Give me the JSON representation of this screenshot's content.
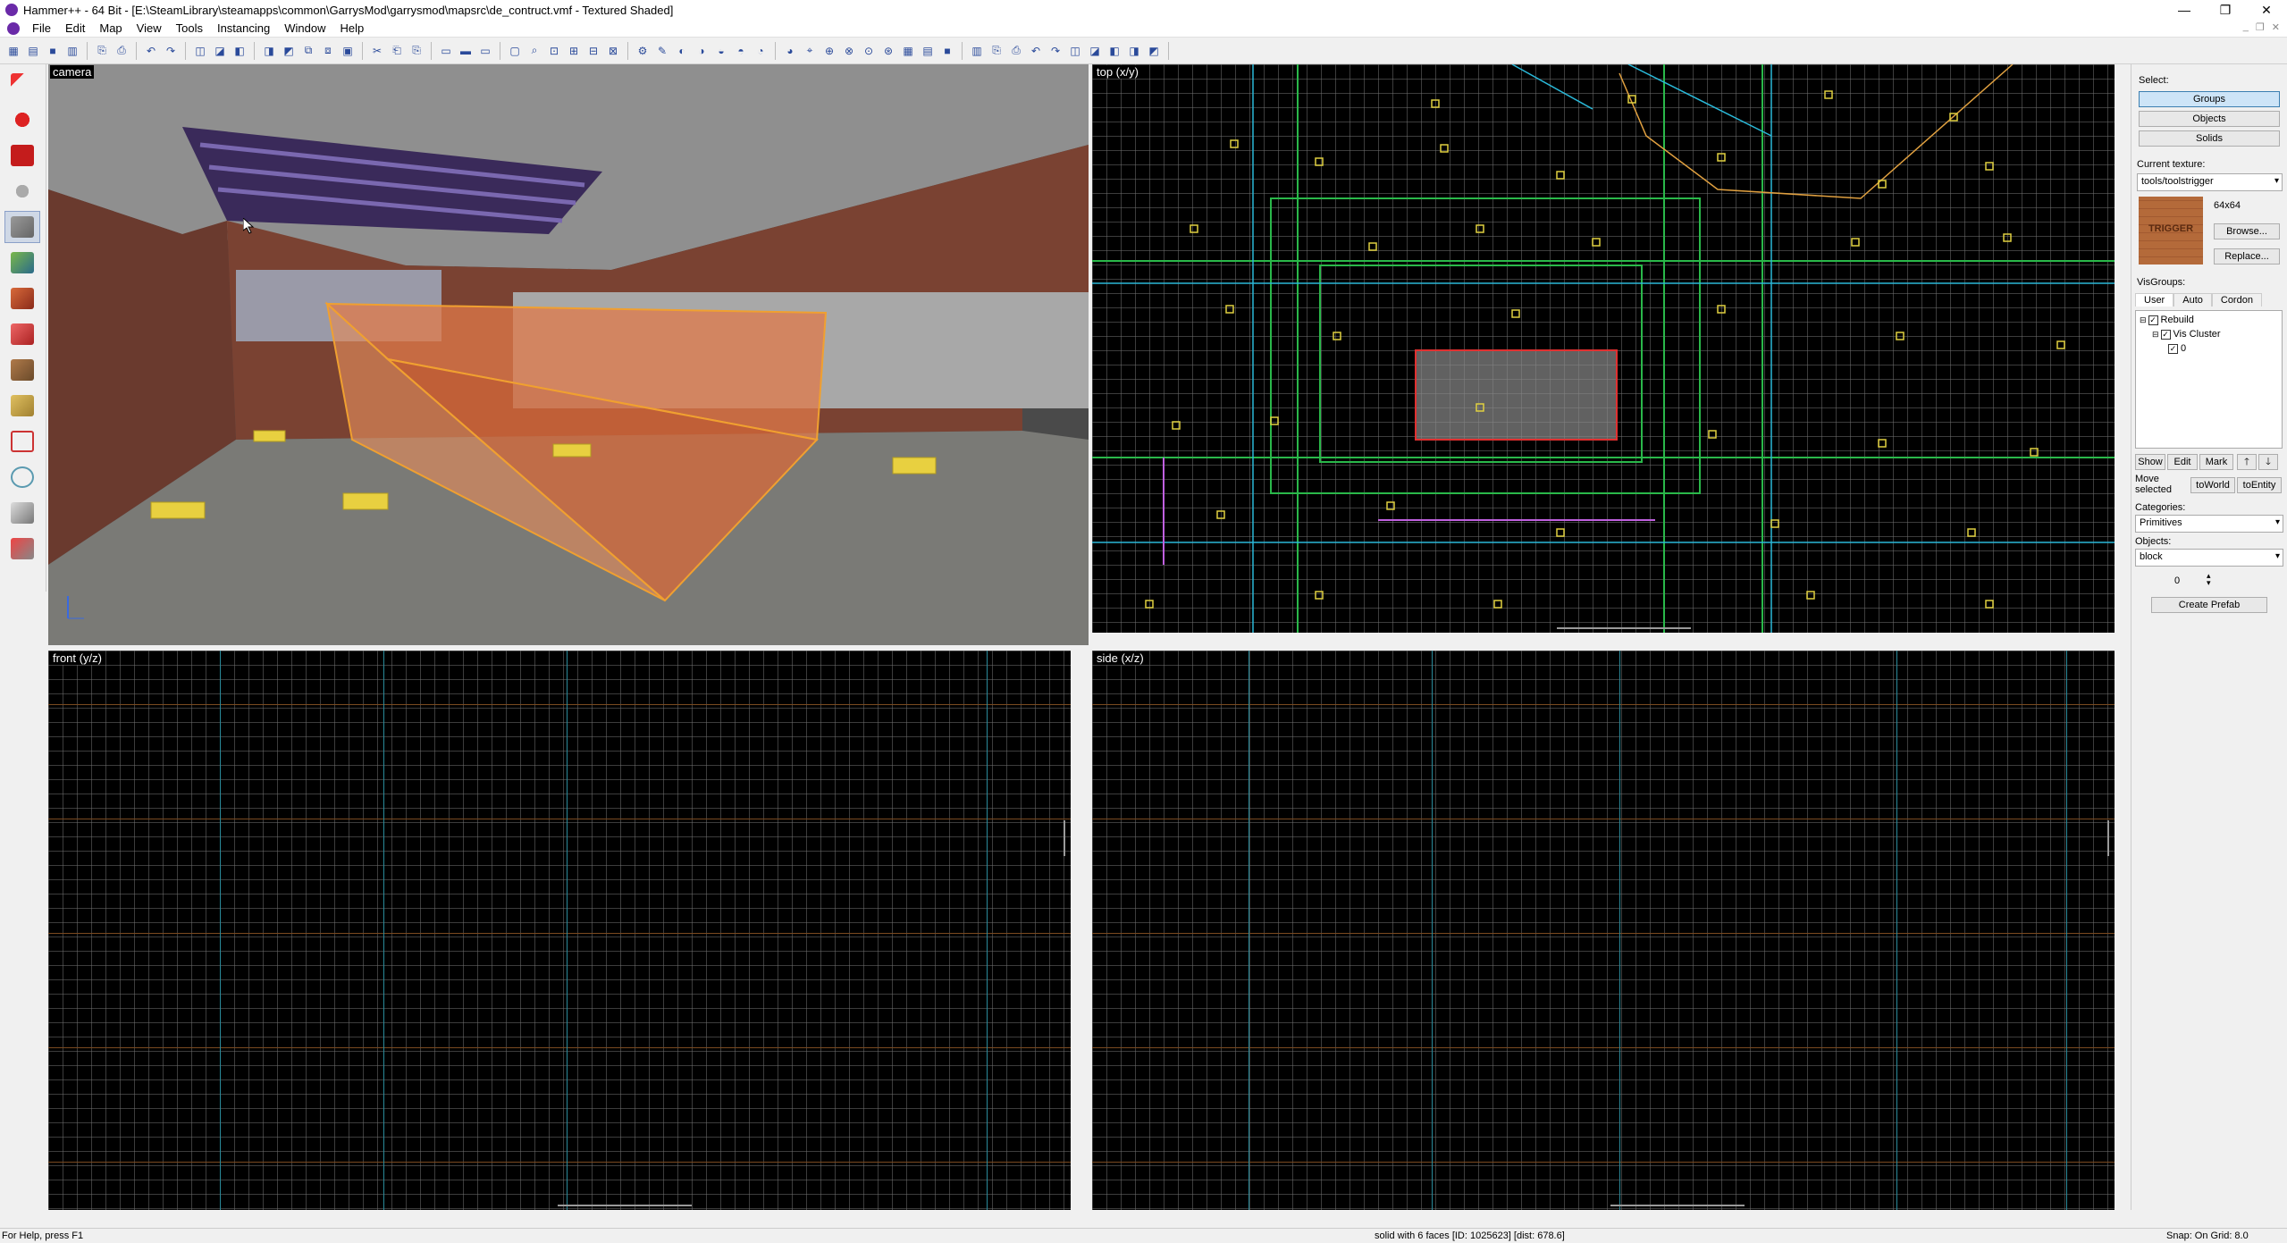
{
  "window": {
    "title": "Hammer++ - 64 Bit - [E:\\SteamLibrary\\steamapps\\common\\GarrysMod\\garrysmod\\mapsrc\\de_contruct.vmf - Textured Shaded]",
    "minimize": "—",
    "restore": "❐",
    "close": "✕"
  },
  "menu": [
    "File",
    "Edit",
    "Map",
    "View",
    "Tools",
    "Instancing",
    "Window",
    "Help"
  ],
  "viewports": {
    "camera": "camera",
    "top": "top (x/y)",
    "front": "front (y/z)",
    "side": "side (x/z)"
  },
  "right_panel": {
    "select_label": "Select:",
    "select_buttons": [
      "Groups",
      "Objects",
      "Solids"
    ],
    "current_texture_label": "Current texture:",
    "current_texture": "tools/toolstrigger",
    "texture_size": "64x64",
    "texture_preview_text": "TRIGGER",
    "browse": "Browse...",
    "replace": "Replace...",
    "visgroups_label": "VisGroups:",
    "visgroup_tabs": [
      "User",
      "Auto",
      "Cordon"
    ],
    "tree": [
      "Rebuild",
      "Vis Cluster",
      "0"
    ],
    "show": "Show",
    "edit": "Edit",
    "mark": "Mark",
    "move_selected": "Move selected",
    "to_world": "toWorld",
    "to_entity": "toEntity",
    "categories_label": "Categories:",
    "categories_value": "Primitives",
    "objects_label": "Objects:",
    "objects_value": "block",
    "spin_value": "0",
    "create_prefab": "Create Prefab"
  },
  "status": {
    "help": "For Help, press F1",
    "selection": "solid with 6 faces  [ID: 1025623]  [dist: 678.6]",
    "snap": "Snap: On Grid: 8.0"
  },
  "colors": {
    "accent": "#3c7fb1",
    "selection_box": "#f0a030",
    "grid_major_h": "#7a4a20",
    "grid_major_v": "#2a8a9a"
  }
}
